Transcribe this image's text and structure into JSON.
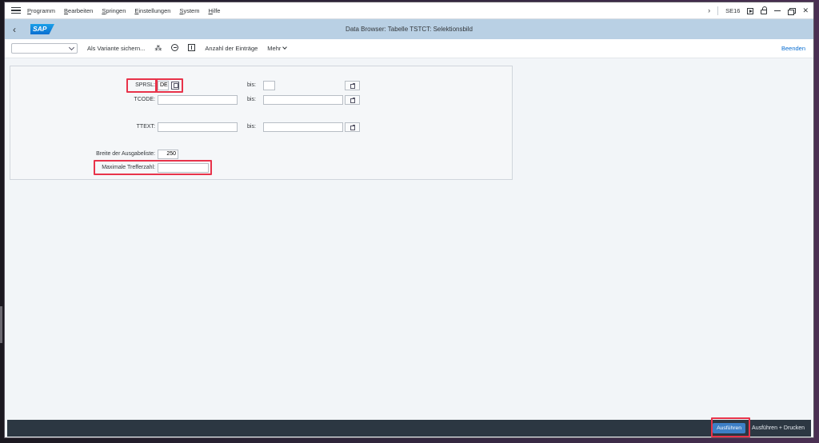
{
  "menubar": {
    "items": [
      "Programm",
      "Bearbeiten",
      "Springen",
      "Einstellungen",
      "System",
      "Hilfe"
    ],
    "tcode": "SE16"
  },
  "header": {
    "logo": "SAP",
    "title": "Data Browser: Tabelle TSTCT: Selektionsbild"
  },
  "toolbar": {
    "variant_value": "",
    "save_variant": "Als Variante sichern...",
    "count_entries": "Anzahl der Einträge",
    "more": "Mehr",
    "exit": "Beenden"
  },
  "form": {
    "sprsl_label": "SPRSL:",
    "sprsl_value": "DE",
    "bis1": "bis:",
    "tcode_label": "TCODE:",
    "bis2": "bis:",
    "ttext_label": "TTEXT:",
    "bis3": "bis:",
    "width_label": "Breite der Ausgabeliste:",
    "width_value": "250",
    "maxhits_label": "Maximale Trefferzahl:",
    "maxhits_value": ""
  },
  "footer": {
    "execute": "Ausführen",
    "execute_print": "Ausführen + Drucken"
  },
  "colors": {
    "header_bg": "#b9d0e4",
    "highlight": "#e8334a",
    "footer_bg": "#2c3742",
    "primary_button": "#3d7fc6"
  }
}
